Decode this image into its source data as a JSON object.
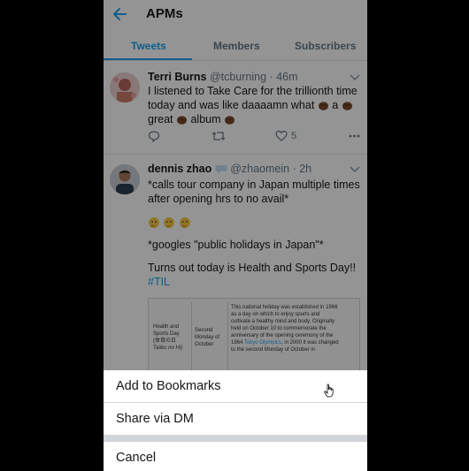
{
  "header": {
    "title": "APMs"
  },
  "tabs": [
    {
      "label": "Tweets",
      "active": true
    },
    {
      "label": "Members",
      "active": false
    },
    {
      "label": "Subscribers",
      "active": false
    }
  ],
  "tweets": [
    {
      "name": "Terri Burns",
      "handle": "@tcburning",
      "time": "· 46m",
      "lines": [
        "I listened to Take Care for the trillionth time",
        "today and was like daaaamn what",
        "a",
        "great",
        "album"
      ],
      "likes": "5"
    },
    {
      "name": "dennis zhao",
      "handle": "@zhaomein",
      "time": "· 2h",
      "line1": "*calls tour company in Japan multiple times",
      "line2": "after opening hrs to no avail*",
      "line3": "*googles \"public holidays in Japan\"*",
      "line4": "Turns out today is Health and Sports Day!!",
      "hashtag": "#TIL",
      "card": {
        "col1_l1": "Health and",
        "col1_l2": "Sports Day",
        "col1_l3": "(体育の日",
        "col1_l4": "Taiiku no Hi)",
        "col2_l1": "Second",
        "col2_l2": "Monday of",
        "col2_l3": "October",
        "col3_l1": "This national holiday was established in 1966",
        "col3_l2": "as a day on which to enjoy sports and",
        "col3_l3": "cultivate a healthy mind and body. Originally",
        "col3_l4": "held on October 10 to commemorate the",
        "col3_l5": "anniversary of the opening ceremony of the",
        "col3_l6_a": "1964 ",
        "col3_l6_link": "Tokyo Olympics",
        "col3_l6_b": ", in 2000 it was changed",
        "col3_l7": "to the second Monday of October in"
      }
    }
  ],
  "sheet": {
    "bookmark": "Add to Bookmarks",
    "dm": "Share via DM",
    "cancel": "Cancel"
  },
  "colors": {
    "accent": "#1da1f2",
    "text": "#14171a",
    "muted": "#657786"
  },
  "icons": [
    "back-arrow-icon",
    "chevron-down-icon",
    "reply-icon",
    "retweet-icon",
    "heart-icon",
    "more-icon",
    "speech-bubble-icon",
    "thinking-face-emoji-icon",
    "fist-emoji-icon",
    "pointer-cursor-icon"
  ]
}
